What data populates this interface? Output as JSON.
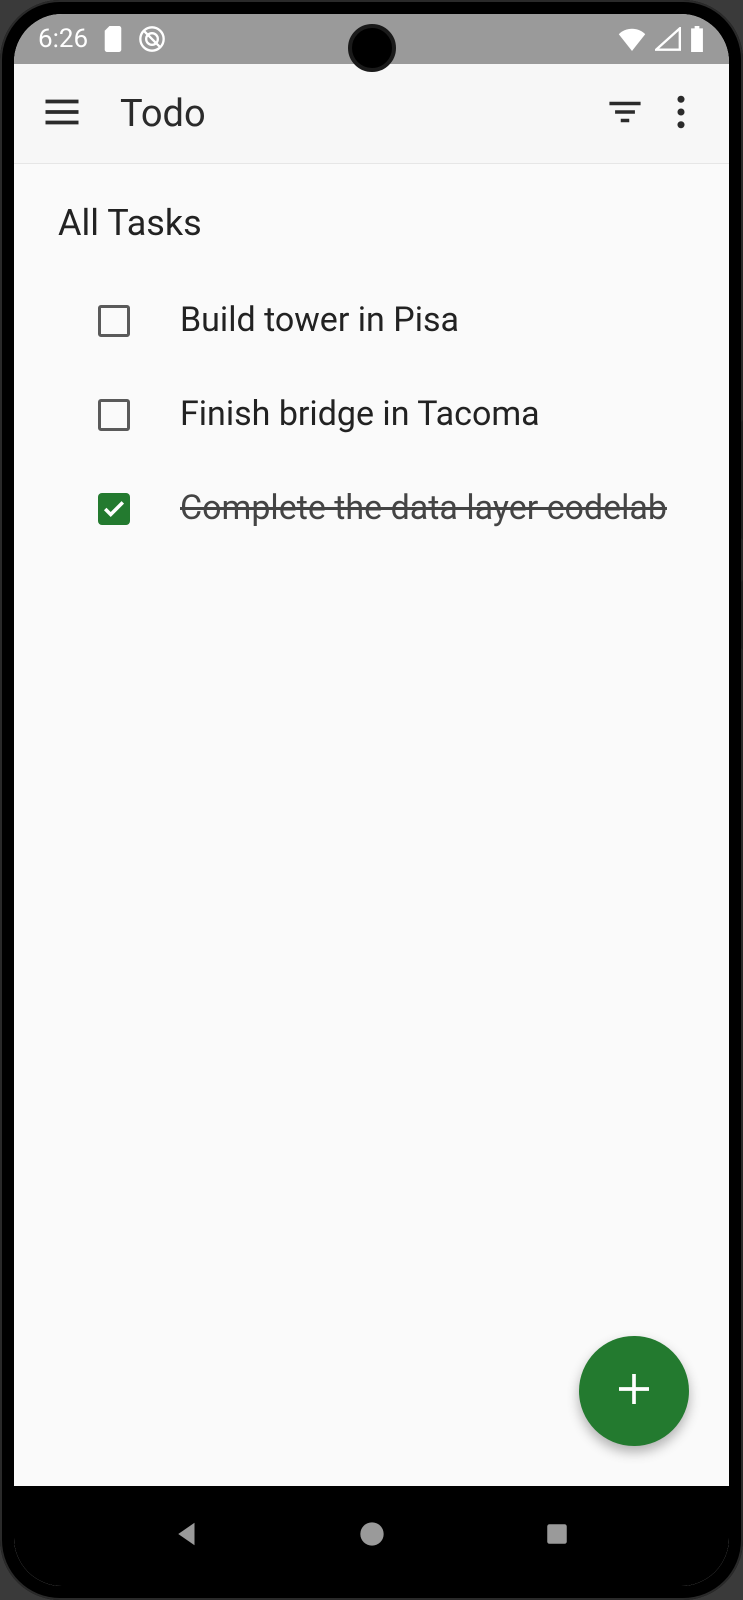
{
  "status_bar": {
    "time": "6:26"
  },
  "app_bar": {
    "title": "Todo"
  },
  "section": {
    "title": "All Tasks"
  },
  "tasks": [
    {
      "label": "Build tower in Pisa",
      "done": false
    },
    {
      "label": "Finish bridge in Tacoma",
      "done": false
    },
    {
      "label": "Complete the data layer codelab",
      "done": true
    }
  ],
  "colors": {
    "accent": "#237a2f"
  }
}
